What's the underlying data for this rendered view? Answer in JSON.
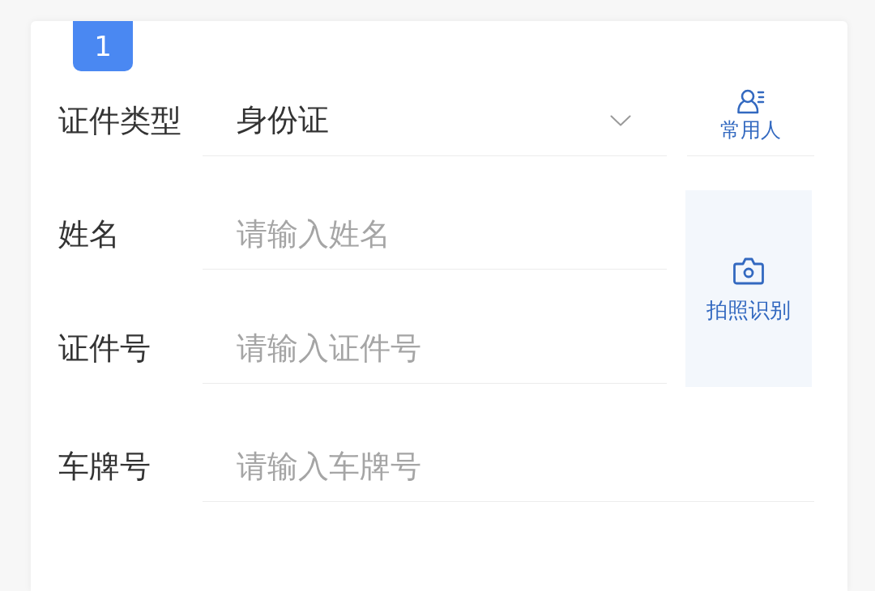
{
  "step_badge": "1",
  "form": {
    "rows": [
      {
        "kind": "select",
        "label": "证件类型",
        "value": "身份证"
      },
      {
        "kind": "input",
        "label": "姓名",
        "placeholder": "请输入姓名"
      },
      {
        "kind": "input",
        "label": "证件号",
        "placeholder": "请输入证件号"
      },
      {
        "kind": "input",
        "label": "车牌号",
        "placeholder": "请输入车牌号"
      }
    ]
  },
  "side_buttons": [
    {
      "kind": "contacts",
      "label": "常用人"
    },
    {
      "kind": "photo",
      "label": "拍照识别"
    }
  ]
}
